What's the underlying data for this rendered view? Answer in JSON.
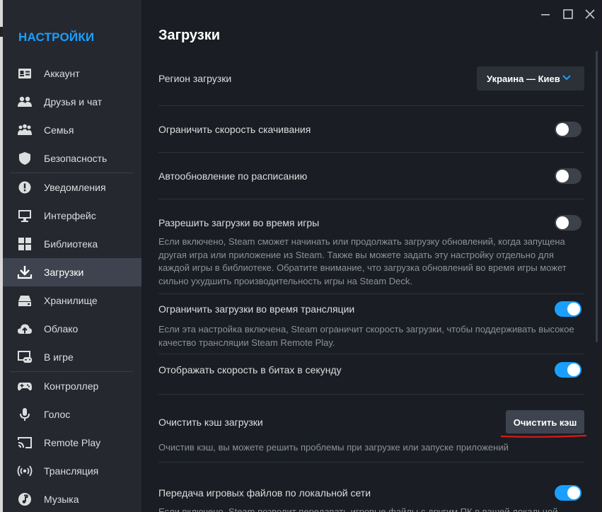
{
  "sidebar": {
    "title": "НАСТРОЙКИ",
    "items": [
      {
        "label": "Аккаунт",
        "icon": "account-card-icon"
      },
      {
        "label": "Друзья и чат",
        "icon": "friends-icon"
      },
      {
        "label": "Семья",
        "icon": "family-icon"
      },
      {
        "label": "Безопасность",
        "icon": "shield-icon"
      },
      {
        "label": "Уведомления",
        "icon": "notification-icon"
      },
      {
        "label": "Интерфейс",
        "icon": "monitor-icon"
      },
      {
        "label": "Библиотека",
        "icon": "library-grid-icon"
      },
      {
        "label": "Загрузки",
        "icon": "download-icon",
        "active": true
      },
      {
        "label": "Хранилище",
        "icon": "storage-drive-icon"
      },
      {
        "label": "Облако",
        "icon": "cloud-icon"
      },
      {
        "label": "В игре",
        "icon": "in-game-icon"
      },
      {
        "label": "Контроллер",
        "icon": "controller-icon"
      },
      {
        "label": "Голос",
        "icon": "microphone-icon"
      },
      {
        "label": "Remote Play",
        "icon": "remote-play-icon"
      },
      {
        "label": "Трансляция",
        "icon": "broadcast-icon"
      },
      {
        "label": "Музыка",
        "icon": "music-icon"
      }
    ]
  },
  "window": {
    "controls": [
      "minimize-icon",
      "maximize-icon",
      "close-icon"
    ]
  },
  "main": {
    "title": "Загрузки",
    "region": {
      "label": "Регион загрузки",
      "value": "Украина — Киев"
    },
    "limit_speed": {
      "label": "Ограничить скорость скачивания",
      "enabled": false
    },
    "schedule": {
      "label": "Автообновление по расписанию",
      "enabled": false
    },
    "during_game": {
      "label": "Разрешить загрузки во время игры",
      "enabled": false,
      "desc_lines": [
        "Если включено, Steam сможет начинать или продолжать загрузку обновлений, когда запущена",
        "другая игра или приложение из Steam. Также вы можете задать эту настройку отдельно для",
        "каждой игры в библиотеке. Обратите внимание, что загрузка обновлений во время игры может",
        "сильно ухудшить производительность игры на Steam Deck."
      ]
    },
    "during_stream": {
      "label": "Ограничить загрузки во время трансляции",
      "enabled": true,
      "desc_lines": [
        "Если эта настройка включена, Steam ограничит скорость загрузки, чтобы поддерживать высокое",
        "качество трансляции Steam Remote Play."
      ]
    },
    "bits": {
      "label": "Отображать скорость в битах в секунду",
      "enabled": true
    },
    "cache": {
      "label": "Очистить кэш загрузки",
      "button": "Очистить кэш",
      "desc": "Очистив кэш, вы можете решить проблемы при загрузке или запуске приложений"
    },
    "lan": {
      "label": "Передача игровых файлов по локальной сети",
      "enabled": true,
      "desc_partial": "Если включено, Steam позволит передавать игровые файлы с другим ПК в вашей локальной"
    }
  },
  "colors": {
    "accent": "#1a9fff",
    "annotation": "#d9191a"
  }
}
